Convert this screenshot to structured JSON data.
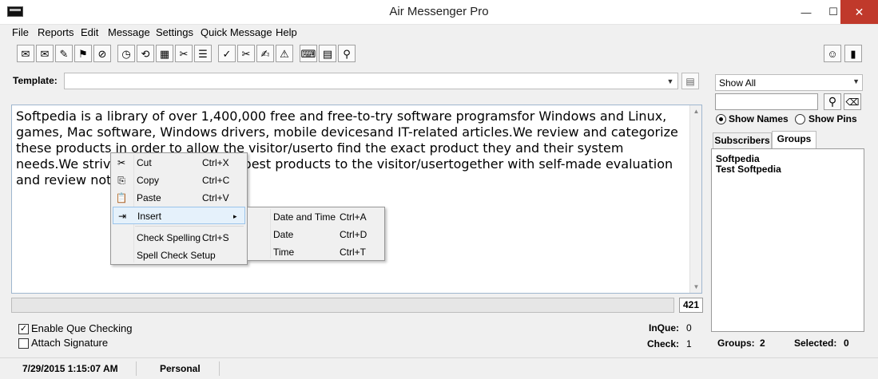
{
  "window": {
    "title": "Air Messenger Pro"
  },
  "menu": [
    "File",
    "Reports",
    "Edit",
    "Message",
    "Settings",
    "Quick Message",
    "Help"
  ],
  "toolbar": {
    "left_icons": [
      "✉",
      "✉",
      "✎",
      "⚑",
      "⊘",
      "◷",
      "⟲",
      "▦",
      "✂",
      "☰",
      "✓",
      "✂",
      "✍",
      "⚠",
      "⌨",
      "▤",
      "⚲"
    ],
    "right_icons": [
      "☺",
      "▮"
    ]
  },
  "template": {
    "label": "Template:",
    "value": ""
  },
  "editor": {
    "text": "Softpedia is a library of over 1,400,000 free and free-to-try software programsfor Windows and Linux, games, Mac software, Windows drivers, mobile devicesand IT-related articles.We review and categorize these products in order to allow the visitor/userto find the exact product they and their system needs.We strive to deliver only the best products to the visitor/usertogether with self-made evaluation and review notes."
  },
  "counter": {
    "value": "421",
    "progress_percent": 0
  },
  "options": {
    "que_checking": {
      "label": "Enable Que Checking",
      "checked": true,
      "mark": "✓"
    },
    "signature": {
      "label": "Attach Signature",
      "checked": false,
      "mark": ""
    }
  },
  "stats": {
    "inque_label": "InQue:",
    "inque_value": "0",
    "check_label": "Check:",
    "check_value": "1"
  },
  "right_panel": {
    "show_select": "Show All",
    "search_value": "",
    "radio_names": "Show Names",
    "radio_pins": "Show Pins",
    "tab_subscribers": "Subscribers",
    "tab_groups": "Groups",
    "groups": [
      "Softpedia",
      "Test Softpedia"
    ],
    "groups_label": "Groups:",
    "groups_count": "2",
    "selected_label": "Selected:",
    "selected_count": "0"
  },
  "status": {
    "datetime": "7/29/2015 1:15:07 AM",
    "profile": "Personal"
  },
  "context_menu": {
    "items": [
      {
        "label": "Cut",
        "shortcut": "Ctrl+X",
        "icon": "✂"
      },
      {
        "label": "Copy",
        "shortcut": "Ctrl+C",
        "icon": "⎘"
      },
      {
        "label": "Paste",
        "shortcut": "Ctrl+V",
        "icon": "📋"
      },
      {
        "label": "Insert",
        "shortcut": "",
        "icon": "⇥",
        "submenu_arrow": "▸"
      },
      {
        "label": "Check Spelling",
        "shortcut": "Ctrl+S",
        "icon": ""
      },
      {
        "label": "Spell Check Setup",
        "shortcut": "",
        "icon": ""
      }
    ]
  },
  "insert_submenu": {
    "items": [
      {
        "label": "Date and Time",
        "shortcut": "Ctrl+A"
      },
      {
        "label": "Date",
        "shortcut": "Ctrl+D"
      },
      {
        "label": "Time",
        "shortcut": "Ctrl+T"
      }
    ]
  },
  "colors": {
    "progress": "#06b025",
    "highlight": "#e5f1fb",
    "close": "#c0392b"
  }
}
